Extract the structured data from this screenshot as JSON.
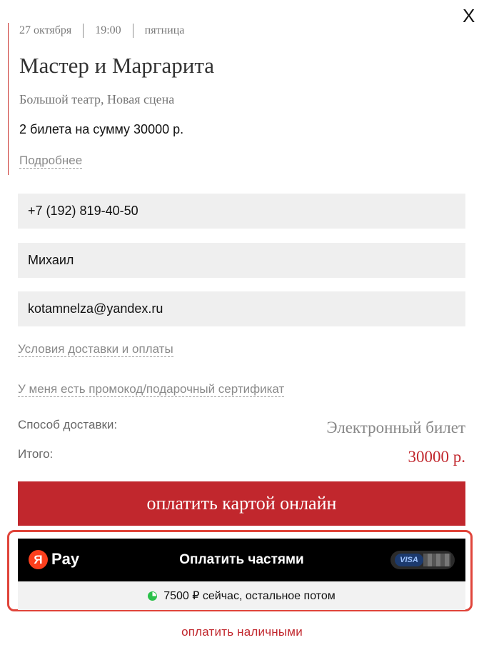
{
  "close_label": "X",
  "event": {
    "date": "27 октября",
    "time": "19:00",
    "weekday": "пятница",
    "title": "Мастер и Маргарита",
    "venue": "Большой театр, Новая сцена",
    "summary": "2 билета на сумму 30000 р.",
    "more_link": "Подробнее"
  },
  "form": {
    "phone": "+7 (192) 819-40-50",
    "name": "Михаил",
    "email": "kotamnelza@yandex.ru"
  },
  "links": {
    "terms": "Условия доставки и оплаты",
    "promo": "У меня есть промокод/подарочный сертификат"
  },
  "delivery": {
    "label": "Способ доставки:",
    "value": "Электронный билет"
  },
  "total": {
    "label": "Итого:",
    "value": "30000 р."
  },
  "buttons": {
    "pay_card": "оплатить картой онлайн",
    "pay_cash": "оплатить наличными"
  },
  "yandex_pay": {
    "logo_letter": "Я",
    "logo_text": "Pay",
    "label": "Оплатить частями",
    "card_brand": "VISA",
    "note": "7500 ₽ сейчас, остальное потом"
  },
  "colors": {
    "accent": "#c1272d",
    "highlight": "#e0443a",
    "yandex_red": "#fc3f1d",
    "field_bg": "#efefef"
  }
}
